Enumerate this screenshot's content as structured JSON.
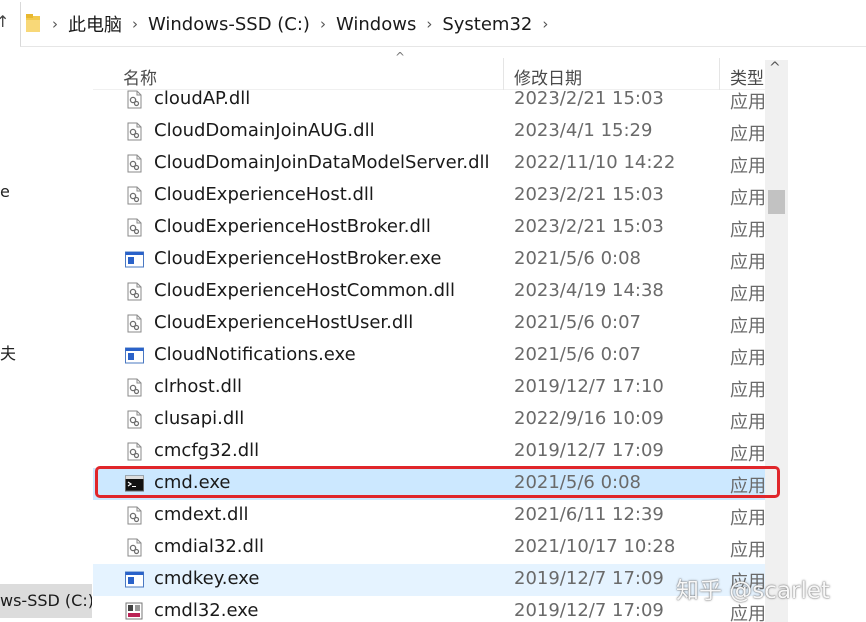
{
  "breadcrumb": [
    "此电脑",
    "Windows-SSD (C:)",
    "Windows",
    "System32"
  ],
  "nav": {
    "fragments": [
      "e",
      "夫"
    ],
    "drive_label": "ws-SSD (C:)"
  },
  "columns": {
    "name": "名称",
    "date": "修改日期",
    "type": "类型"
  },
  "files": [
    {
      "name": "cloudAP.dll",
      "date": "2023/2/21 15:03",
      "type": "应用",
      "kind": "dll"
    },
    {
      "name": "CloudDomainJoinAUG.dll",
      "date": "2023/4/1 15:29",
      "type": "应用",
      "kind": "dll"
    },
    {
      "name": "CloudDomainJoinDataModelServer.dll",
      "date": "2022/11/10 14:22",
      "type": "应用",
      "kind": "dll"
    },
    {
      "name": "CloudExperienceHost.dll",
      "date": "2023/2/21 15:03",
      "type": "应用",
      "kind": "dll"
    },
    {
      "name": "CloudExperienceHostBroker.dll",
      "date": "2023/2/21 15:03",
      "type": "应用",
      "kind": "dll"
    },
    {
      "name": "CloudExperienceHostBroker.exe",
      "date": "2021/5/6 0:08",
      "type": "应用",
      "kind": "exe"
    },
    {
      "name": "CloudExperienceHostCommon.dll",
      "date": "2023/4/19 14:38",
      "type": "应用",
      "kind": "dll"
    },
    {
      "name": "CloudExperienceHostUser.dll",
      "date": "2021/5/6 0:07",
      "type": "应用",
      "kind": "dll"
    },
    {
      "name": "CloudNotifications.exe",
      "date": "2021/5/6 0:07",
      "type": "应用",
      "kind": "exe"
    },
    {
      "name": "clrhost.dll",
      "date": "2019/12/7 17:10",
      "type": "应用",
      "kind": "dll"
    },
    {
      "name": "clusapi.dll",
      "date": "2022/9/16 10:09",
      "type": "应用",
      "kind": "dll"
    },
    {
      "name": "cmcfg32.dll",
      "date": "2019/12/7 17:09",
      "type": "应用",
      "kind": "dll"
    },
    {
      "name": "cmd.exe",
      "date": "2021/5/6 0:08",
      "type": "应用",
      "kind": "cmd",
      "state": "selected"
    },
    {
      "name": "cmdext.dll",
      "date": "2021/6/11 12:39",
      "type": "应用",
      "kind": "dll"
    },
    {
      "name": "cmdial32.dll",
      "date": "2021/10/17 10:28",
      "type": "应用",
      "kind": "dll"
    },
    {
      "name": "cmdkey.exe",
      "date": "2019/12/7 17:09",
      "type": "应用",
      "kind": "exe",
      "state": "hover"
    },
    {
      "name": "cmdl32.exe",
      "date": "2019/12/7 17:09",
      "type": "应用",
      "kind": "exe2"
    }
  ],
  "watermark": "知乎 @scarlet",
  "colors": {
    "selected": "#cce8ff",
    "hover": "#e5f3ff",
    "highlight": "#e0262a"
  }
}
